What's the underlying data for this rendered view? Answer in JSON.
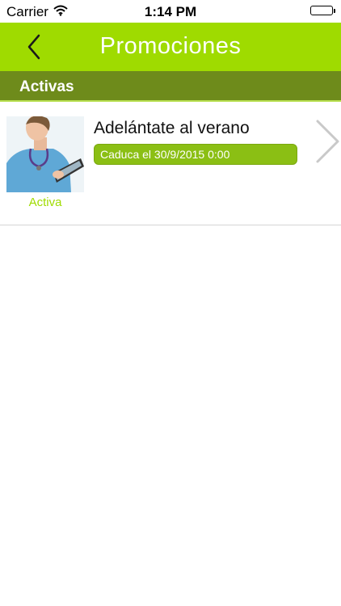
{
  "status_bar": {
    "carrier": "Carrier",
    "time": "1:14 PM"
  },
  "nav": {
    "title": "Promociones",
    "back_icon": "chevron-left-icon",
    "color": "#9fdb00"
  },
  "section": {
    "title": "Activas",
    "color": "#6e8b1b"
  },
  "promotions": [
    {
      "title": "Adelántate al verano",
      "expiry": "Caduca el 30/9/2015 0:00",
      "status": "Activa",
      "badge_color": "#8bbf14",
      "image": "nurse-with-tablet-photo"
    }
  ]
}
